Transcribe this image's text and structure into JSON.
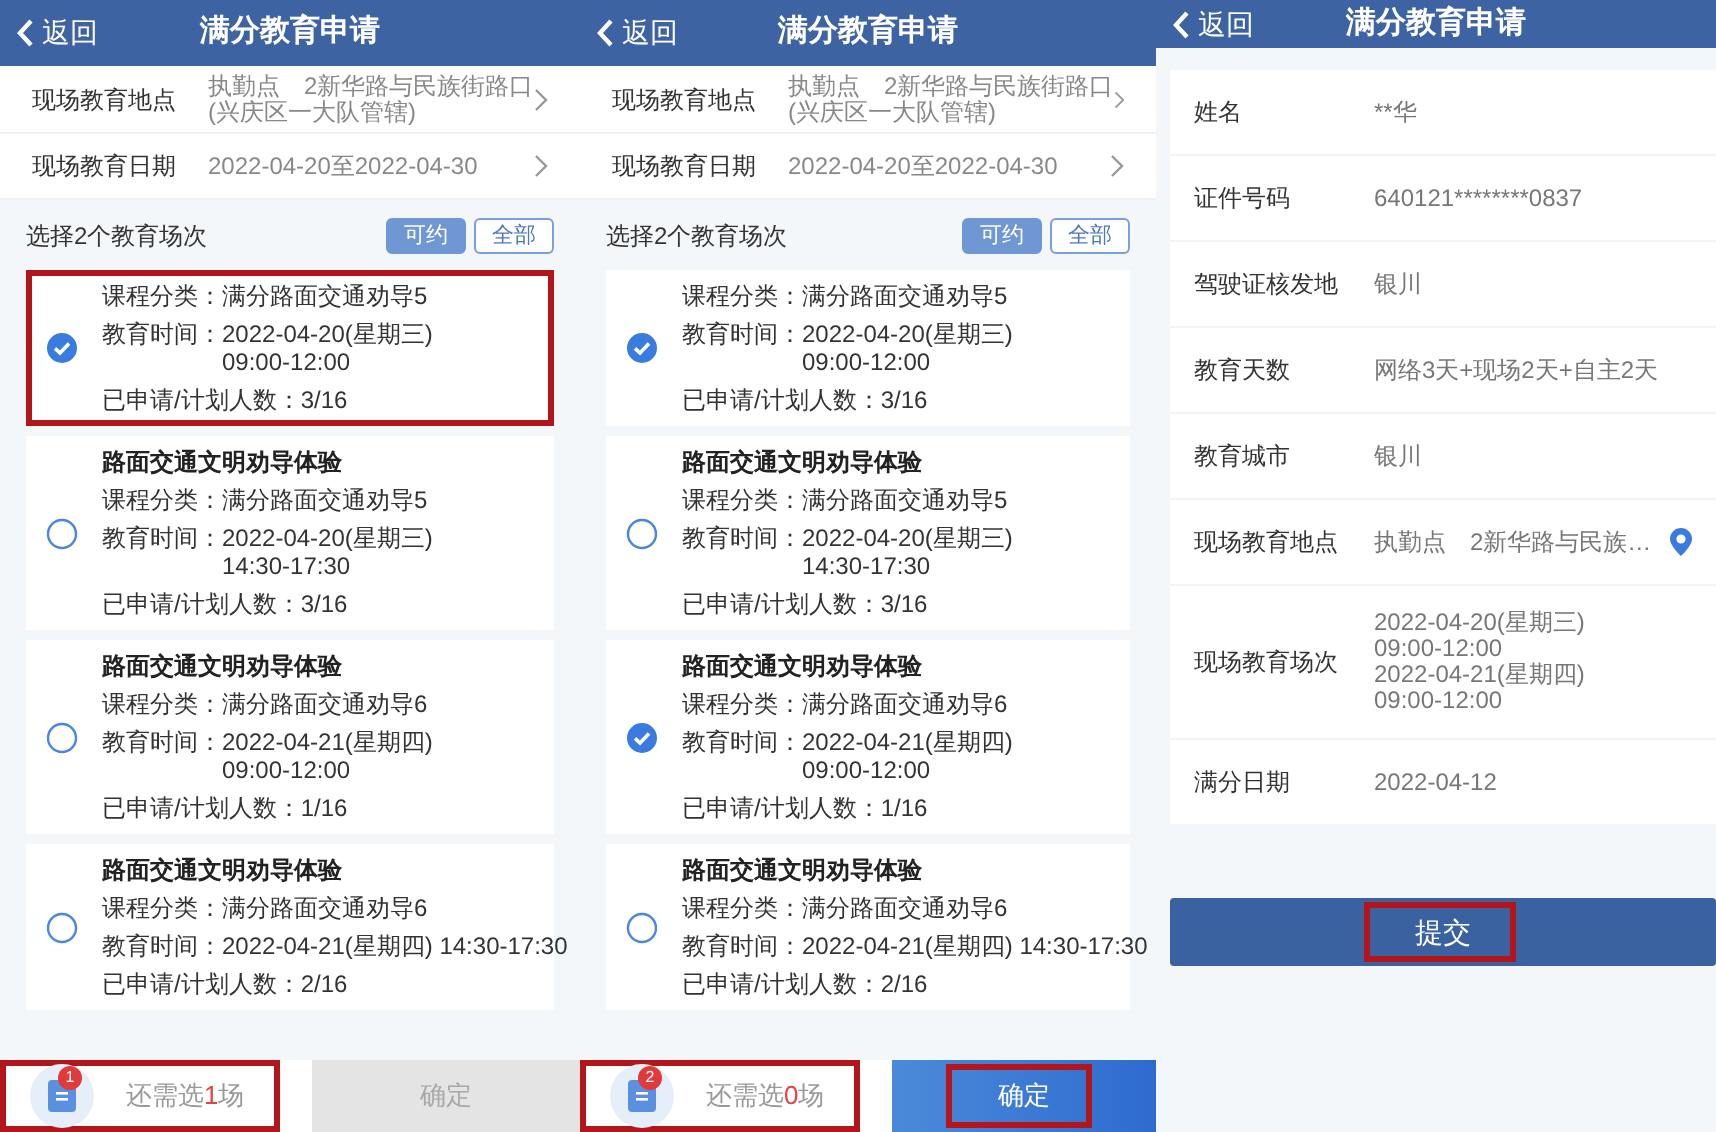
{
  "screens": [
    {
      "kind": "sessions",
      "header": {
        "back": "返回",
        "title": "满分教育申请"
      },
      "fields": [
        {
          "label": "现场教育地点",
          "value_lines": [
            "执勤点　2新华路与民族街路口",
            "(兴庆区一大队管辖)"
          ]
        },
        {
          "label": "现场教育日期",
          "value_lines": [
            "2022-04-20至2022-04-30"
          ]
        }
      ],
      "prompt": "选择2个教育场次",
      "filters": [
        {
          "label": "可约",
          "selected": true
        },
        {
          "label": "全部",
          "selected": false
        }
      ],
      "sessions": [
        {
          "category_label": "课程分类：",
          "category": "满分路面交通劝导5",
          "time_label": "教育时间：",
          "time_lines": [
            "2022-04-20(星期三)",
            "09:00-12:00"
          ],
          "count_label": "已申请/计划人数：",
          "count": "3/16",
          "selected": true,
          "highlighted": true
        },
        {
          "title": "路面交通文明劝导体验",
          "category_label": "课程分类：",
          "category": "满分路面交通劝导5",
          "time_label": "教育时间：",
          "time_lines": [
            "2022-04-20(星期三)",
            "14:30-17:30"
          ],
          "count_label": "已申请/计划人数：",
          "count": "3/16",
          "selected": false,
          "highlighted": false
        },
        {
          "title": "路面交通文明劝导体验",
          "category_label": "课程分类：",
          "category": "满分路面交通劝导6",
          "time_label": "教育时间：",
          "time_lines": [
            "2022-04-21(星期四)",
            "09:00-12:00"
          ],
          "count_label": "已申请/计划人数：",
          "count": "1/16",
          "selected": false,
          "highlighted": false
        },
        {
          "title": "路面交通文明劝导体验",
          "category_label": "课程分类：",
          "category": "满分路面交通劝导6",
          "time_label": "教育时间：",
          "time_lines": [
            "2022-04-21(星期四) 14:30-17:30"
          ],
          "count_label": "已申请/计划人数：",
          "count": "2/16",
          "selected": false,
          "highlighted": false
        }
      ],
      "summary": {
        "badge": "1",
        "prefix": "还需选",
        "remaining": "1",
        "suffix": "场",
        "highlighted": true
      },
      "confirm": {
        "label": "确定",
        "disabled": true,
        "highlighted": false
      }
    },
    {
      "kind": "sessions",
      "header": {
        "back": "返回",
        "title": "满分教育申请"
      },
      "fields": [
        {
          "label": "现场教育地点",
          "value_lines": [
            "执勤点　2新华路与民族街路口",
            "(兴庆区一大队管辖)"
          ]
        },
        {
          "label": "现场教育日期",
          "value_lines": [
            "2022-04-20至2022-04-30"
          ]
        }
      ],
      "prompt": "选择2个教育场次",
      "filters": [
        {
          "label": "可约",
          "selected": true
        },
        {
          "label": "全部",
          "selected": false
        }
      ],
      "sessions": [
        {
          "category_label": "课程分类：",
          "category": "满分路面交通劝导5",
          "time_label": "教育时间：",
          "time_lines": [
            "2022-04-20(星期三)",
            "09:00-12:00"
          ],
          "count_label": "已申请/计划人数：",
          "count": "3/16",
          "selected": true,
          "highlighted": false
        },
        {
          "title": "路面交通文明劝导体验",
          "category_label": "课程分类：",
          "category": "满分路面交通劝导5",
          "time_label": "教育时间：",
          "time_lines": [
            "2022-04-20(星期三)",
            "14:30-17:30"
          ],
          "count_label": "已申请/计划人数：",
          "count": "3/16",
          "selected": false,
          "highlighted": false
        },
        {
          "title": "路面交通文明劝导体验",
          "category_label": "课程分类：",
          "category": "满分路面交通劝导6",
          "time_label": "教育时间：",
          "time_lines": [
            "2022-04-21(星期四)",
            "09:00-12:00"
          ],
          "count_label": "已申请/计划人数：",
          "count": "1/16",
          "selected": true,
          "highlighted": false
        },
        {
          "title": "路面交通文明劝导体验",
          "category_label": "课程分类：",
          "category": "满分路面交通劝导6",
          "time_label": "教育时间：",
          "time_lines": [
            "2022-04-21(星期四) 14:30-17:30"
          ],
          "count_label": "已申请/计划人数：",
          "count": "2/16",
          "selected": false,
          "highlighted": false
        }
      ],
      "summary": {
        "badge": "2",
        "prefix": "还需选",
        "remaining": "0",
        "suffix": "场",
        "highlighted": true
      },
      "confirm": {
        "label": "确定",
        "disabled": false,
        "highlighted": true
      }
    },
    {
      "kind": "review",
      "header": {
        "back": "返回",
        "title": "满分教育申请"
      },
      "details": [
        {
          "kind": "text",
          "label": "姓名",
          "value_lines": [
            "**华"
          ]
        },
        {
          "kind": "text",
          "label": "证件号码",
          "value_lines": [
            "640121********0837"
          ]
        },
        {
          "kind": "text",
          "label": "驾驶证核发地",
          "value_lines": [
            "银川"
          ]
        },
        {
          "kind": "text",
          "label": "教育天数",
          "value_lines": [
            "网络3天+现场2天+自主2天"
          ]
        },
        {
          "kind": "text",
          "label": "教育城市",
          "value_lines": [
            "银川"
          ]
        },
        {
          "kind": "location",
          "label": "现场教育地点",
          "value_lines": [
            "执勤点　2新华路与民族…"
          ]
        },
        {
          "kind": "text",
          "label": "现场教育场次",
          "value_lines": [
            "2022-04-20(星期三)",
            "09:00-12:00",
            "2022-04-21(星期四)",
            "09:00-12:00"
          ]
        },
        {
          "kind": "text",
          "label": "满分日期",
          "value_lines": [
            "2022-04-12"
          ]
        }
      ],
      "submit": {
        "label": "提交",
        "highlighted": true
      }
    }
  ]
}
